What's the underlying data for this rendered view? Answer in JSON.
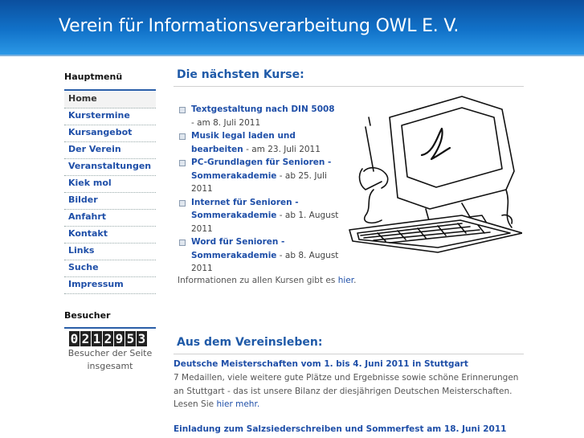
{
  "header": {
    "title": "Verein für Informationsverarbeitung OWL E. V."
  },
  "sidebar": {
    "menu_heading": "Hauptmenü",
    "menu_items": [
      {
        "label": "Home",
        "active": true
      },
      {
        "label": "Kurstermine"
      },
      {
        "label": "Kursangebot"
      },
      {
        "label": "Der Verein"
      },
      {
        "label": "Veranstaltungen"
      },
      {
        "label": "Kiek mol"
      },
      {
        "label": "Bilder"
      },
      {
        "label": "Anfahrt"
      },
      {
        "label": "Kontakt"
      },
      {
        "label": "Links"
      },
      {
        "label": "Suche"
      },
      {
        "label": "Impressum"
      }
    ],
    "visitor_heading": "Besucher",
    "counter_value": "0212953",
    "visitor_caption": "Besucher der Seite insgesamt"
  },
  "courses": {
    "title": "Die nächsten Kurse:",
    "items": [
      {
        "link": "Textgestaltung nach DIN 5008",
        "suffix": " - am 8. Juli 2011"
      },
      {
        "link": "Musik legal laden und bearbeiten",
        "suffix": " - am 23. Juli 2011"
      },
      {
        "link": "PC-Grundlagen für Senioren - Sommerakademie",
        "suffix": " - ab 25. Juli 2011"
      },
      {
        "link": "Internet für Senioren - Sommerakademie",
        "suffix": " - ab 1. August 2011"
      },
      {
        "link": "Word für Senioren - Sommerakademie",
        "suffix": " - ab 8. August 2011"
      }
    ],
    "info_text": "Informationen zu allen Kursen gibt es ",
    "info_link": "hier",
    "info_end": "."
  },
  "club": {
    "title": "Aus dem Vereinsleben:",
    "news1_title": "Deutsche Meisterschaften vom 1. bis 4. Juni 2011 in Stuttgart",
    "news1_text": "7 Medaillen, viele weitere gute Plätze und Ergebnisse sowie schöne Erinnerungen an Stuttgart - das ist unsere Bilanz der diesjährigen Deutschen Meisterschaften. Lesen Sie ",
    "news1_link": "hier mehr.",
    "news2_title": "Einladung zum Salzsiederschreiben und Sommerfest am 18. Juni 2011"
  },
  "colors": {
    "header": "#1172c9",
    "link": "#1f4fa8",
    "heading": "#1f5aa8"
  }
}
